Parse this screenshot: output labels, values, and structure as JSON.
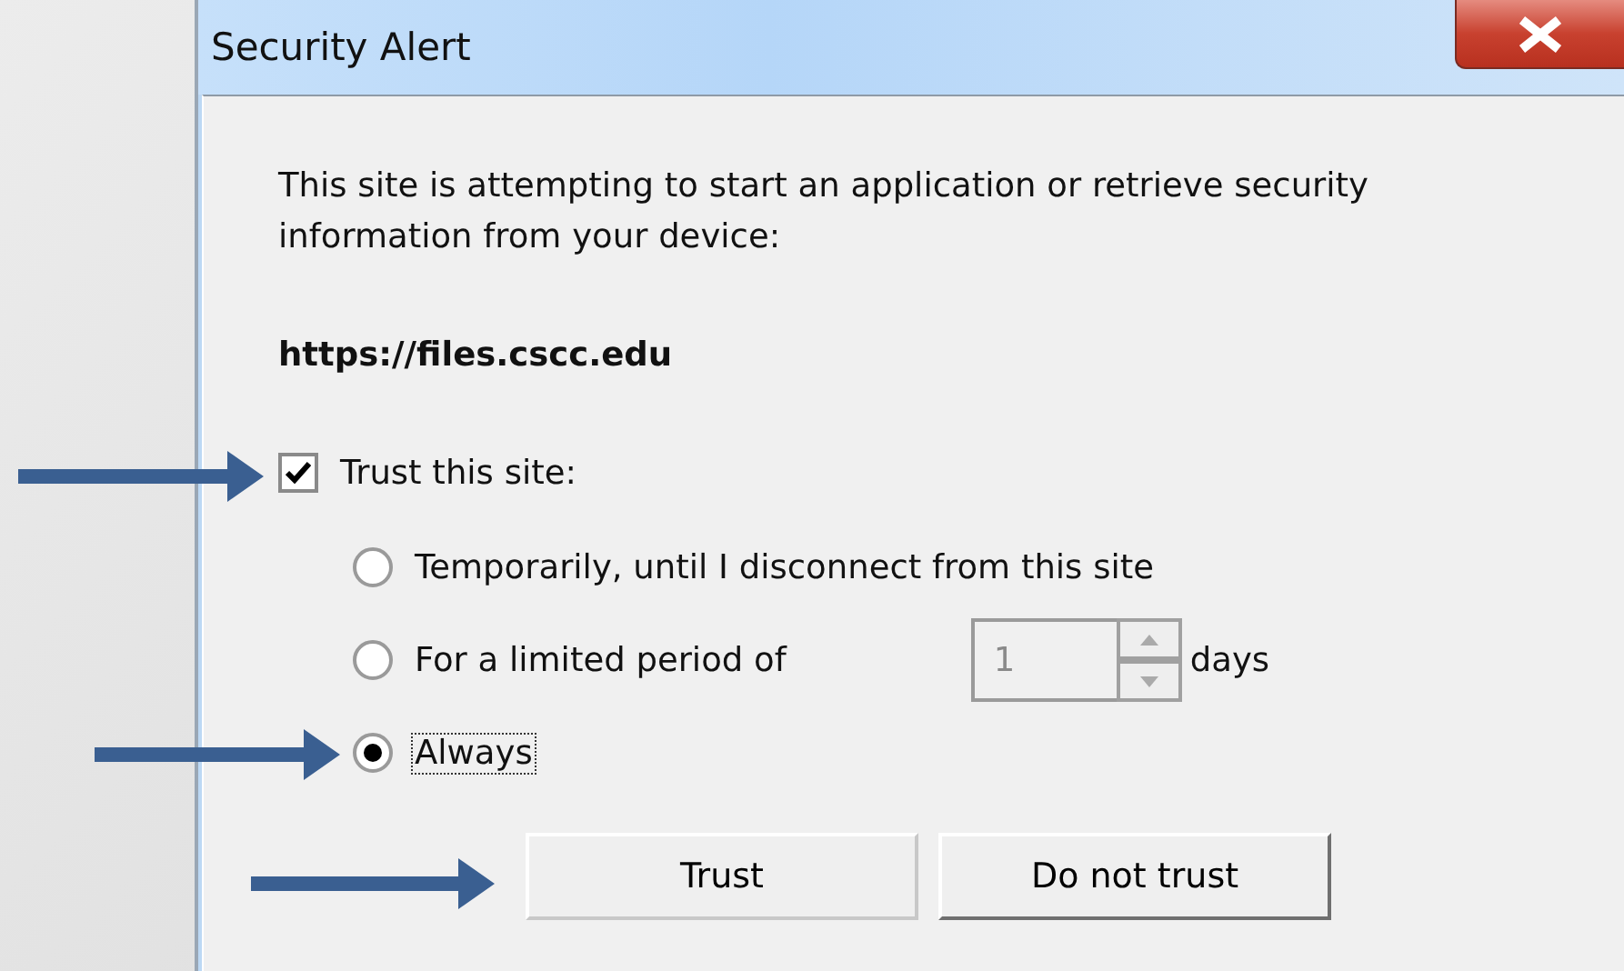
{
  "window": {
    "title": "Security Alert"
  },
  "message": "This site is attempting to start an application or retrieve security information from your device:",
  "url": "https://files.cscc.edu",
  "trust_checkbox": {
    "label": "Trust this site:",
    "checked": true
  },
  "options": [
    {
      "kind": "plain",
      "label": "Temporarily, until I disconnect from this site",
      "selected": false,
      "focused": false
    },
    {
      "kind": "period",
      "label": "For a limited period of",
      "selected": false,
      "focused": false,
      "field": {
        "value": "1",
        "disabled": true
      },
      "unit": "days"
    },
    {
      "kind": "plain",
      "label": "Always",
      "selected": true,
      "focused": true
    }
  ],
  "buttons": [
    {
      "label": "Trust"
    },
    {
      "label": "Do not trust"
    }
  ]
}
